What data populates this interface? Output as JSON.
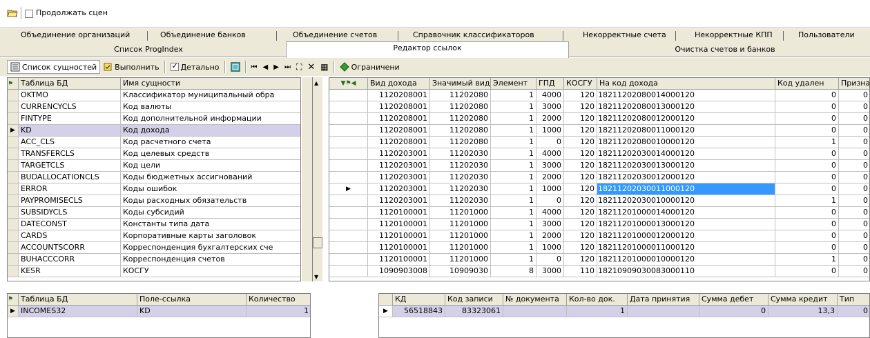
{
  "toolbar_top": {
    "continue_label": "Продолжать сцен"
  },
  "tabs_row1": [
    "Объединение организаций",
    "Объединение банков",
    "Объединение счетов",
    "Справочник классификаторов",
    "Некорректные счета",
    "Некорректные КПП",
    "Пользователи"
  ],
  "tabs_row2": [
    "Список ProgIndex",
    "Редактор ссылок",
    "Очистка счетов и банков"
  ],
  "toolbar2": {
    "entities_label": "Список сущностей",
    "execute_label": "Выполнить",
    "detail_label": "Детально",
    "restrict_label": "Ограничени"
  },
  "left_grid": {
    "headers": [
      "Таблица БД",
      "Имя сущности"
    ],
    "rows": [
      [
        "OKTMO",
        "Классификатор муниципальный обра"
      ],
      [
        "CURRENCYCLS",
        "Код валюты"
      ],
      [
        "FINTYPE",
        "Код дополнительной информации"
      ],
      [
        "KD",
        "Код дохода"
      ],
      [
        "ACC_CLS",
        "Код расчетного счета"
      ],
      [
        "TRANSFERCLS",
        "Код целевых средств"
      ],
      [
        "TARGETCLS",
        "Код цели"
      ],
      [
        "BUDALLOCATIONCLS",
        "Коды бюджетных ассигнований"
      ],
      [
        "ERROR",
        "Коды ошибок"
      ],
      [
        "PAYPROMISECLS",
        "Коды расходных обязательств"
      ],
      [
        "SUBSIDYCLS",
        "Коды субсидий"
      ],
      [
        "DATECONST",
        "Константы типа дата"
      ],
      [
        "CARDS",
        "Корпоративные карты заголовок"
      ],
      [
        "ACCOUNTSCORR",
        "Корреспонденция бухгалтерских сче"
      ],
      [
        "BUHACCCORR",
        "Корреспонденция счетов"
      ],
      [
        "KESR",
        "КОСГУ"
      ]
    ],
    "selected_index": 3
  },
  "right_grid": {
    "headers": [
      "Вид дохода",
      "Значимый вид д...",
      "Элемент",
      "ГПД",
      "КОСГУ",
      "На код дохода",
      "Код удален",
      "Признак"
    ],
    "rows": [
      [
        "1120208001",
        "11202080",
        "1",
        "4000",
        "120",
        "18211202080014000120",
        "0",
        "0"
      ],
      [
        "1120208001",
        "11202080",
        "1",
        "3000",
        "120",
        "18211202080013000120",
        "0",
        "0"
      ],
      [
        "1120208001",
        "11202080",
        "1",
        "2000",
        "120",
        "18211202080012000120",
        "0",
        "0"
      ],
      [
        "1120208001",
        "11202080",
        "1",
        "1000",
        "120",
        "18211202080011000120",
        "0",
        "0"
      ],
      [
        "1120208001",
        "11202080",
        "1",
        "0",
        "120",
        "18211202080010000120",
        "1",
        "0"
      ],
      [
        "1120203001",
        "11202030",
        "1",
        "4000",
        "120",
        "18211202030014000120",
        "0",
        "0"
      ],
      [
        "1120203001",
        "11202030",
        "1",
        "3000",
        "120",
        "18211202030013000120",
        "0",
        "0"
      ],
      [
        "1120203001",
        "11202030",
        "1",
        "2000",
        "120",
        "18211202030012000120",
        "0",
        "0"
      ],
      [
        "1120203001",
        "11202030",
        "1",
        "1000",
        "120",
        "18211202030011000120",
        "0",
        "0"
      ],
      [
        "1120203001",
        "11202030",
        "1",
        "0",
        "120",
        "18211202030010000120",
        "1",
        "0"
      ],
      [
        "1120100001",
        "11201000",
        "1",
        "4000",
        "120",
        "18211201000014000120",
        "0",
        "0"
      ],
      [
        "1120100001",
        "11201000",
        "1",
        "3000",
        "120",
        "18211201000013000120",
        "0",
        "0"
      ],
      [
        "1120100001",
        "11201000",
        "1",
        "2000",
        "120",
        "18211201000012000120",
        "0",
        "0"
      ],
      [
        "1120100001",
        "11201000",
        "1",
        "1000",
        "120",
        "18211201000011000120",
        "0",
        "0"
      ],
      [
        "1120100001",
        "11201000",
        "1",
        "0",
        "120",
        "18211201000010000120",
        "1",
        "0"
      ],
      [
        "1090903008",
        "10909030",
        "8",
        "3000",
        "110",
        "18210909030083000110",
        "0",
        "0"
      ]
    ],
    "selected_index": 8
  },
  "bottom_left": {
    "headers": [
      "Таблица БД",
      "Поле-ссылка",
      "Количество"
    ],
    "rows": [
      [
        "INCOMES32",
        "KD",
        "1"
      ]
    ]
  },
  "bottom_right": {
    "headers": [
      "КД",
      "Код записи",
      "№ документа",
      "Кол-во док.",
      "Дата принятия",
      "Сумма дебет",
      "Сумма кредит",
      "Тип"
    ],
    "rows": [
      [
        "56518843",
        "83323061",
        "",
        "1",
        "",
        "0",
        "13,3",
        "0"
      ]
    ]
  },
  "colors": {
    "selected_bg": "#3399ff",
    "row_selected_bg": "#d4d0e8",
    "header_bg": "#ece9d8"
  }
}
